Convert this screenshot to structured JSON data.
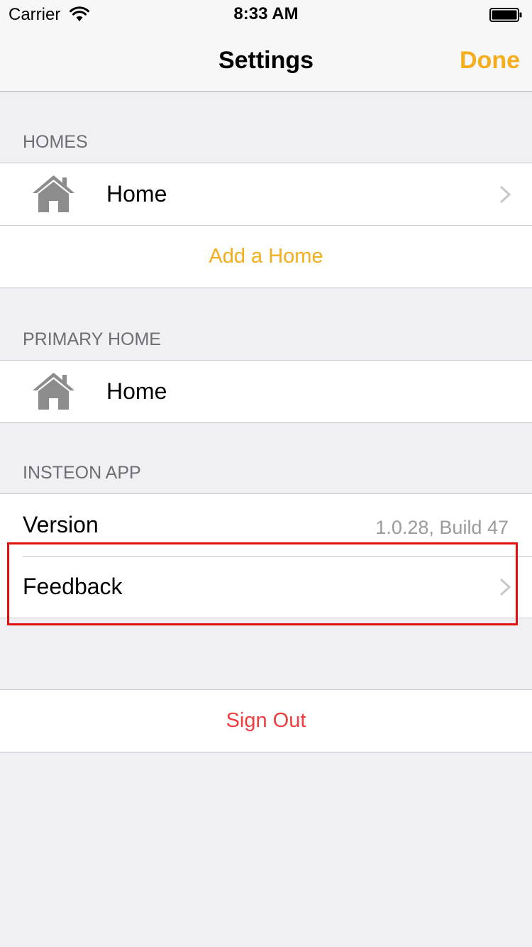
{
  "status_bar": {
    "carrier": "Carrier",
    "time": "8:33 AM"
  },
  "nav": {
    "title": "Settings",
    "done_label": "Done"
  },
  "homes_section": {
    "header": "HOMES",
    "items": [
      {
        "label": "Home",
        "icon": "house-icon"
      }
    ],
    "add_label": "Add a Home"
  },
  "primary_home_section": {
    "header": "PRIMARY HOME",
    "item": {
      "label": "Home",
      "icon": "house-icon"
    }
  },
  "app_section": {
    "header": "INSTEON APP",
    "version_label": "Version",
    "version_value": "1.0.28, Build 47",
    "feedback_label": "Feedback"
  },
  "sign_out_label": "Sign Out",
  "colors": {
    "accent": "#f4ad1b",
    "destructive": "#f03d3f",
    "highlight": "#e01010",
    "background": "#efeff4"
  }
}
